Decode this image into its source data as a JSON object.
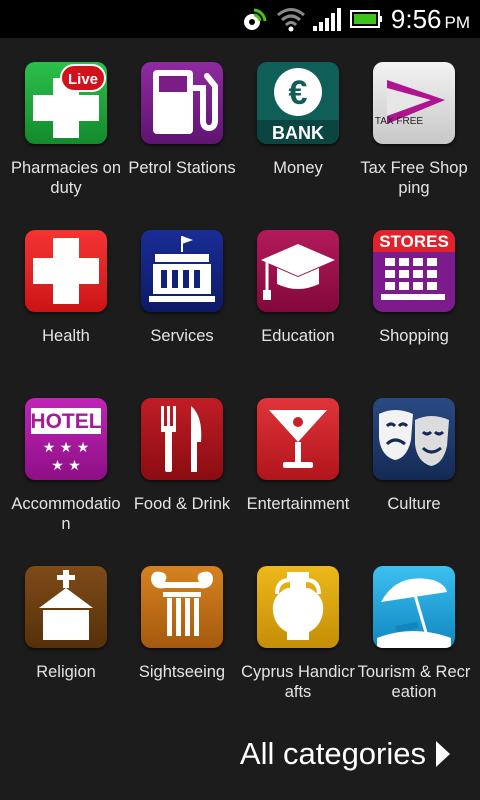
{
  "status_bar": {
    "time": "9:56",
    "ampm": "PM",
    "icons": [
      "sync-icon",
      "wifi-icon",
      "signal-icon",
      "battery-icon"
    ]
  },
  "categories": [
    {
      "label": "Pharmacies on duty",
      "icon": "pharmacy-live-icon",
      "badge": "Live",
      "color": "#1aa33c"
    },
    {
      "label": "Petrol Stations",
      "icon": "fuel-pump-icon",
      "color": "#7a1e86"
    },
    {
      "label": "Money",
      "icon": "euro-bank-icon",
      "text": "BANK",
      "color": "#0f5e57"
    },
    {
      "label": "Tax Free Shopping",
      "icon": "tax-free-icon",
      "text": "TAX FREE",
      "color": "#dcdcdc"
    },
    {
      "label": "Health",
      "icon": "red-cross-icon",
      "color": "#e02020"
    },
    {
      "label": "Services",
      "icon": "government-building-icon",
      "color": "#12217a"
    },
    {
      "label": "Education",
      "icon": "graduation-cap-icon",
      "color": "#9c1048"
    },
    {
      "label": "Shopping",
      "icon": "stores-icon",
      "text": "STORES",
      "color": "#7c1b8c"
    },
    {
      "label": "Accommodation",
      "icon": "hotel-stars-icon",
      "text": "HOTEL",
      "color": "#a31b9a"
    },
    {
      "label": "Food & Drink",
      "icon": "fork-knife-icon",
      "color": "#a1141c"
    },
    {
      "label": "Entertainment",
      "icon": "cocktail-glass-icon",
      "color": "#c92226"
    },
    {
      "label": "Culture",
      "icon": "theatre-masks-icon",
      "color": "#1d3766"
    },
    {
      "label": "Religion",
      "icon": "church-icon",
      "color": "#6b3e12"
    },
    {
      "label": "Sightseeing",
      "icon": "ionic-column-icon",
      "color": "#c0701a"
    },
    {
      "label": "Cyprus Handicrafts",
      "icon": "amphora-icon",
      "color": "#d8a20e"
    },
    {
      "label": "Tourism & Recreation",
      "icon": "beach-umbrella-icon",
      "color": "#19a6dd"
    }
  ],
  "footer": {
    "all_categories_label": "All categories"
  }
}
